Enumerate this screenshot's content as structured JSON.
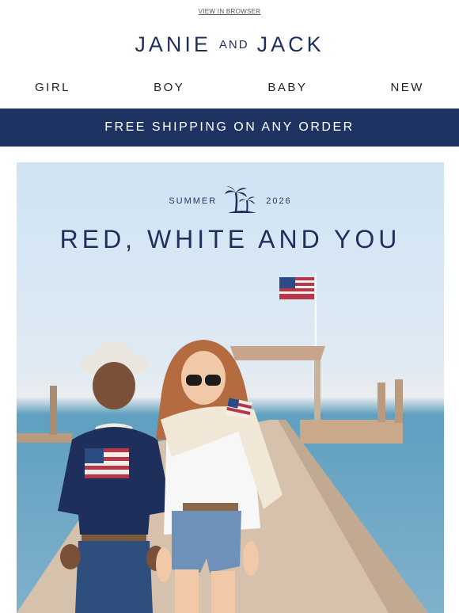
{
  "preheader": {
    "link_label": "VIEW IN BROWSER"
  },
  "brand": {
    "name_left": "JANIE",
    "name_middle": "AND",
    "name_right": "JACK"
  },
  "nav": {
    "items": [
      "GIRL",
      "BOY",
      "BABY",
      "NEW"
    ]
  },
  "banner": {
    "text": "FREE SHIPPING ON ANY ORDER"
  },
  "hero": {
    "season_left": "SUMMER",
    "season_right": "2026",
    "headline": "RED, WHITE AND YOU",
    "icon": "palm-trees-icon"
  },
  "colors": {
    "navy": "#1f3362",
    "text_navy": "#1f2f5c",
    "sky": "#cfe3f4",
    "water": "#6ea7c6"
  }
}
